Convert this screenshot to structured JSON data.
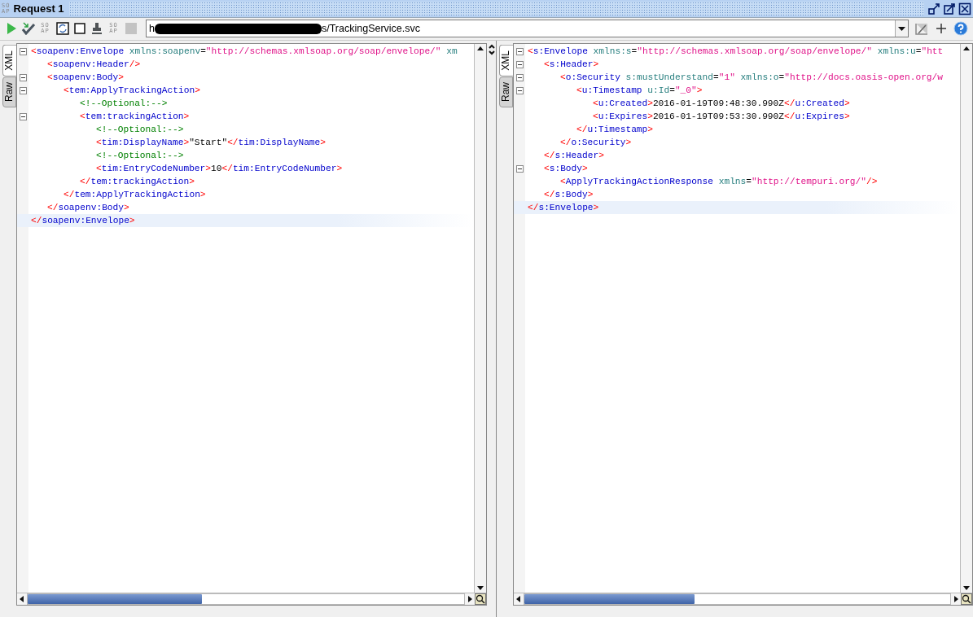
{
  "window": {
    "logo": [
      "SO",
      "AP"
    ],
    "title": "Request 1"
  },
  "toolbar": [
    {
      "kind": "run",
      "disabled": false
    },
    {
      "kind": "validate",
      "disabled": false
    },
    {
      "kind": "soap",
      "label": [
        "SO",
        "AP"
      ],
      "disabled": false
    },
    {
      "kind": "sync",
      "disabled": false
    },
    {
      "kind": "square",
      "disabled": false
    },
    {
      "kind": "stamp",
      "disabled": false
    },
    {
      "kind": "soap",
      "label": [
        "SO",
        "AP"
      ],
      "disabled": false
    },
    {
      "kind": "stop",
      "disabled": true
    }
  ],
  "endpoint": {
    "start": "h",
    "redacted": true,
    "end": "s/TrackingService.svc"
  },
  "panes": [
    {
      "tabs": [
        {
          "label": "XML",
          "selected": true
        },
        {
          "label": "Raw",
          "selected": false
        }
      ],
      "lines": [
        {
          "fold": true,
          "current": false,
          "tokens": [
            {
              "kind": "bracket",
              "text": "<"
            },
            {
              "kind": "tag",
              "text": "soapenv:Envelope"
            },
            {
              "kind": "attr",
              "text": " xmlns:soapenv"
            },
            {
              "kind": "text",
              "text": "="
            },
            {
              "kind": "value",
              "text": "\"http://schemas.xmlsoap.org/soap/envelope/\""
            },
            {
              "kind": "attr",
              "text": " xm"
            }
          ],
          "children": [
            {
              "fold": false,
              "current": false,
              "tokens": [
                {
                  "kind": "bracket",
                  "text": "<"
                },
                {
                  "kind": "tag",
                  "text": "soapenv:Header"
                },
                {
                  "kind": "bracket",
                  "text": "/>"
                }
              ]
            },
            {
              "fold": true,
              "current": false,
              "tokens": [
                {
                  "kind": "bracket",
                  "text": "<"
                },
                {
                  "kind": "tag",
                  "text": "soapenv:Body"
                },
                {
                  "kind": "bracket",
                  "text": ">"
                }
              ],
              "children": [
                {
                  "fold": true,
                  "current": false,
                  "tokens": [
                    {
                      "kind": "bracket",
                      "text": "<"
                    },
                    {
                      "kind": "tag",
                      "text": "tem:ApplyTrackingAction"
                    },
                    {
                      "kind": "bracket",
                      "text": ">"
                    }
                  ],
                  "children": [
                    {
                      "fold": false,
                      "current": false,
                      "tokens": [
                        {
                          "kind": "comment",
                          "text": "<!--Optional:-->"
                        }
                      ]
                    },
                    {
                      "fold": true,
                      "current": false,
                      "tokens": [
                        {
                          "kind": "bracket",
                          "text": "<"
                        },
                        {
                          "kind": "tag",
                          "text": "tem:trackingAction"
                        },
                        {
                          "kind": "bracket",
                          "text": ">"
                        }
                      ],
                      "children": [
                        {
                          "fold": false,
                          "current": false,
                          "tokens": [
                            {
                              "kind": "comment",
                              "text": "<!--Optional:-->"
                            }
                          ]
                        },
                        {
                          "fold": false,
                          "current": false,
                          "tokens": [
                            {
                              "kind": "bracket",
                              "text": "<"
                            },
                            {
                              "kind": "tag",
                              "text": "tim:DisplayName"
                            },
                            {
                              "kind": "bracket",
                              "text": ">"
                            },
                            {
                              "kind": "text",
                              "text": "\"Start\""
                            },
                            {
                              "kind": "bracket",
                              "text": "</"
                            },
                            {
                              "kind": "tag",
                              "text": "tim:DisplayName"
                            },
                            {
                              "kind": "bracket",
                              "text": ">"
                            }
                          ]
                        },
                        {
                          "fold": false,
                          "current": false,
                          "tokens": [
                            {
                              "kind": "comment",
                              "text": "<!--Optional:-->"
                            }
                          ]
                        },
                        {
                          "fold": false,
                          "current": false,
                          "tokens": [
                            {
                              "kind": "bracket",
                              "text": "<"
                            },
                            {
                              "kind": "tag",
                              "text": "tim:EntryCodeNumber"
                            },
                            {
                              "kind": "bracket",
                              "text": ">"
                            },
                            {
                              "kind": "text",
                              "text": "10"
                            },
                            {
                              "kind": "bracket",
                              "text": "</"
                            },
                            {
                              "kind": "tag",
                              "text": "tim:EntryCodeNumber"
                            },
                            {
                              "kind": "bracket",
                              "text": ">"
                            }
                          ]
                        }
                      ]
                    },
                    {
                      "fold": false,
                      "current": false,
                      "tokens": [
                        {
                          "kind": "bracket",
                          "text": "</"
                        },
                        {
                          "kind": "tag",
                          "text": "tem:trackingAction"
                        },
                        {
                          "kind": "bracket",
                          "text": ">"
                        }
                      ]
                    }
                  ]
                },
                {
                  "fold": false,
                  "current": false,
                  "tokens": [
                    {
                      "kind": "bracket",
                      "text": "</"
                    },
                    {
                      "kind": "tag",
                      "text": "tem:ApplyTrackingAction"
                    },
                    {
                      "kind": "bracket",
                      "text": ">"
                    }
                  ]
                }
              ]
            },
            {
              "fold": false,
              "current": false,
              "tokens": [
                {
                  "kind": "bracket",
                  "text": "</"
                },
                {
                  "kind": "tag",
                  "text": "soapenv:Body"
                },
                {
                  "kind": "bracket",
                  "text": ">"
                }
              ]
            }
          ]
        },
        {
          "fold": false,
          "current": true,
          "tokens": [
            {
              "kind": "bracket",
              "text": "</"
            },
            {
              "kind": "tag",
              "text": "soapenv:Envelope"
            },
            {
              "kind": "bracket",
              "text": ">"
            }
          ]
        }
      ]
    },
    {
      "tabs": [
        {
          "label": "XML",
          "selected": true
        },
        {
          "label": "Raw",
          "selected": false
        }
      ],
      "lines": [
        {
          "fold": true,
          "current": false,
          "tokens": [
            {
              "kind": "bracket",
              "text": "<"
            },
            {
              "kind": "tag",
              "text": "s:Envelope"
            },
            {
              "kind": "attr",
              "text": " xmlns:s"
            },
            {
              "kind": "text",
              "text": "="
            },
            {
              "kind": "value",
              "text": "\"http://schemas.xmlsoap.org/soap/envelope/\""
            },
            {
              "kind": "attr",
              "text": " xmlns:u"
            },
            {
              "kind": "text",
              "text": "="
            },
            {
              "kind": "value",
              "text": "\"htt"
            }
          ],
          "children": [
            {
              "fold": true,
              "current": false,
              "tokens": [
                {
                  "kind": "bracket",
                  "text": "<"
                },
                {
                  "kind": "tag",
                  "text": "s:Header"
                },
                {
                  "kind": "bracket",
                  "text": ">"
                }
              ],
              "children": [
                {
                  "fold": true,
                  "current": false,
                  "tokens": [
                    {
                      "kind": "bracket",
                      "text": "<"
                    },
                    {
                      "kind": "tag",
                      "text": "o:Security"
                    },
                    {
                      "kind": "attr",
                      "text": " s:mustUnderstand"
                    },
                    {
                      "kind": "text",
                      "text": "="
                    },
                    {
                      "kind": "value",
                      "text": "\"1\""
                    },
                    {
                      "kind": "attr",
                      "text": " xmlns:o"
                    },
                    {
                      "kind": "text",
                      "text": "="
                    },
                    {
                      "kind": "value",
                      "text": "\"http://docs.oasis-open.org/w"
                    }
                  ],
                  "children": [
                    {
                      "fold": true,
                      "current": false,
                      "tokens": [
                        {
                          "kind": "bracket",
                          "text": "<"
                        },
                        {
                          "kind": "tag",
                          "text": "u:Timestamp"
                        },
                        {
                          "kind": "attr",
                          "text": " u:Id"
                        },
                        {
                          "kind": "text",
                          "text": "="
                        },
                        {
                          "kind": "value",
                          "text": "\"_0\""
                        },
                        {
                          "kind": "bracket",
                          "text": ">"
                        }
                      ],
                      "children": [
                        {
                          "fold": false,
                          "current": false,
                          "tokens": [
                            {
                              "kind": "bracket",
                              "text": "<"
                            },
                            {
                              "kind": "tag",
                              "text": "u:Created"
                            },
                            {
                              "kind": "bracket",
                              "text": ">"
                            },
                            {
                              "kind": "text",
                              "text": "2016-01-19T09:48:30.990Z"
                            },
                            {
                              "kind": "bracket",
                              "text": "</"
                            },
                            {
                              "kind": "tag",
                              "text": "u:Created"
                            },
                            {
                              "kind": "bracket",
                              "text": ">"
                            }
                          ]
                        },
                        {
                          "fold": false,
                          "current": false,
                          "tokens": [
                            {
                              "kind": "bracket",
                              "text": "<"
                            },
                            {
                              "kind": "tag",
                              "text": "u:Expires"
                            },
                            {
                              "kind": "bracket",
                              "text": ">"
                            },
                            {
                              "kind": "text",
                              "text": "2016-01-19T09:53:30.990Z"
                            },
                            {
                              "kind": "bracket",
                              "text": "</"
                            },
                            {
                              "kind": "tag",
                              "text": "u:Expires"
                            },
                            {
                              "kind": "bracket",
                              "text": ">"
                            }
                          ]
                        }
                      ]
                    },
                    {
                      "fold": false,
                      "current": false,
                      "tokens": [
                        {
                          "kind": "bracket",
                          "text": "</"
                        },
                        {
                          "kind": "tag",
                          "text": "u:Timestamp"
                        },
                        {
                          "kind": "bracket",
                          "text": ">"
                        }
                      ]
                    }
                  ]
                },
                {
                  "fold": false,
                  "current": false,
                  "tokens": [
                    {
                      "kind": "bracket",
                      "text": "</"
                    },
                    {
                      "kind": "tag",
                      "text": "o:Security"
                    },
                    {
                      "kind": "bracket",
                      "text": ">"
                    }
                  ]
                }
              ]
            },
            {
              "fold": false,
              "current": false,
              "tokens": [
                {
                  "kind": "bracket",
                  "text": "</"
                },
                {
                  "kind": "tag",
                  "text": "s:Header"
                },
                {
                  "kind": "bracket",
                  "text": ">"
                }
              ]
            },
            {
              "fold": true,
              "current": false,
              "tokens": [
                {
                  "kind": "bracket",
                  "text": "<"
                },
                {
                  "kind": "tag",
                  "text": "s:Body"
                },
                {
                  "kind": "bracket",
                  "text": ">"
                }
              ],
              "children": [
                {
                  "fold": false,
                  "current": false,
                  "tokens": [
                    {
                      "kind": "bracket",
                      "text": "<"
                    },
                    {
                      "kind": "tag",
                      "text": "ApplyTrackingActionResponse"
                    },
                    {
                      "kind": "attr",
                      "text": " xmlns"
                    },
                    {
                      "kind": "text",
                      "text": "="
                    },
                    {
                      "kind": "value",
                      "text": "\"http://tempuri.org/\""
                    },
                    {
                      "kind": "bracket",
                      "text": "/>"
                    }
                  ]
                }
              ]
            },
            {
              "fold": false,
              "current": false,
              "tokens": [
                {
                  "kind": "bracket",
                  "text": "</"
                },
                {
                  "kind": "tag",
                  "text": "s:Body"
                },
                {
                  "kind": "bracket",
                  "text": ">"
                }
              ]
            }
          ]
        },
        {
          "fold": false,
          "current": true,
          "tokens": [
            {
              "kind": "bracket",
              "text": "</"
            },
            {
              "kind": "tag",
              "text": "s:Envelope"
            },
            {
              "kind": "bracket",
              "text": ">"
            }
          ]
        }
      ]
    }
  ]
}
